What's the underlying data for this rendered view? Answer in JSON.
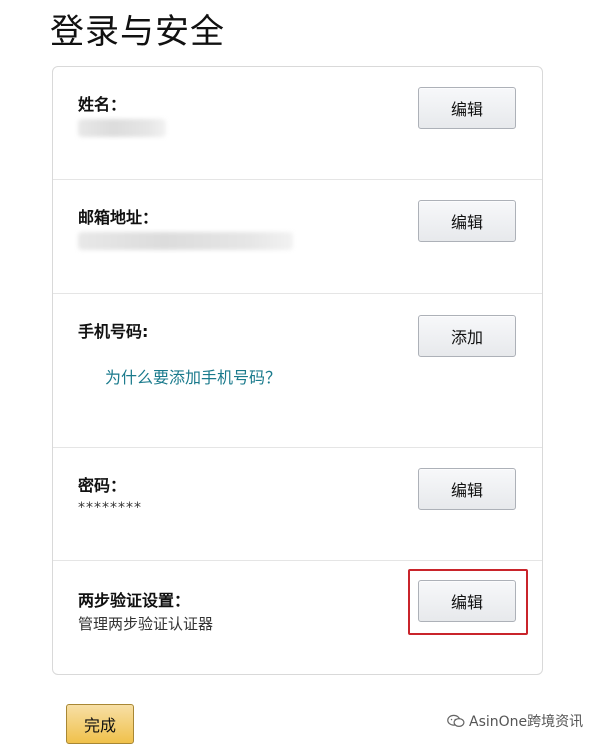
{
  "page": {
    "title": "登录与安全"
  },
  "rows": [
    {
      "label": "姓名：",
      "value_hidden": true,
      "button_label": "编辑"
    },
    {
      "label": "邮箱地址：",
      "value_hidden": true,
      "button_label": "编辑"
    },
    {
      "label": "手机号码:",
      "help_link": "为什么要添加手机号码？",
      "button_label": "添加"
    },
    {
      "label": "密码：",
      "value": "********",
      "button_label": "编辑"
    },
    {
      "label": "两步验证设置：",
      "value": "管理两步验证认证器",
      "button_label": "编辑",
      "highlighted": true
    }
  ],
  "footer": {
    "done_label": "完成"
  },
  "watermark": {
    "text": "AsinOne跨境资讯",
    "icon": "wechat-icon"
  },
  "colors": {
    "highlight": "#c9242b",
    "link": "#1a7a8c",
    "done_button": "#f0c14b"
  }
}
